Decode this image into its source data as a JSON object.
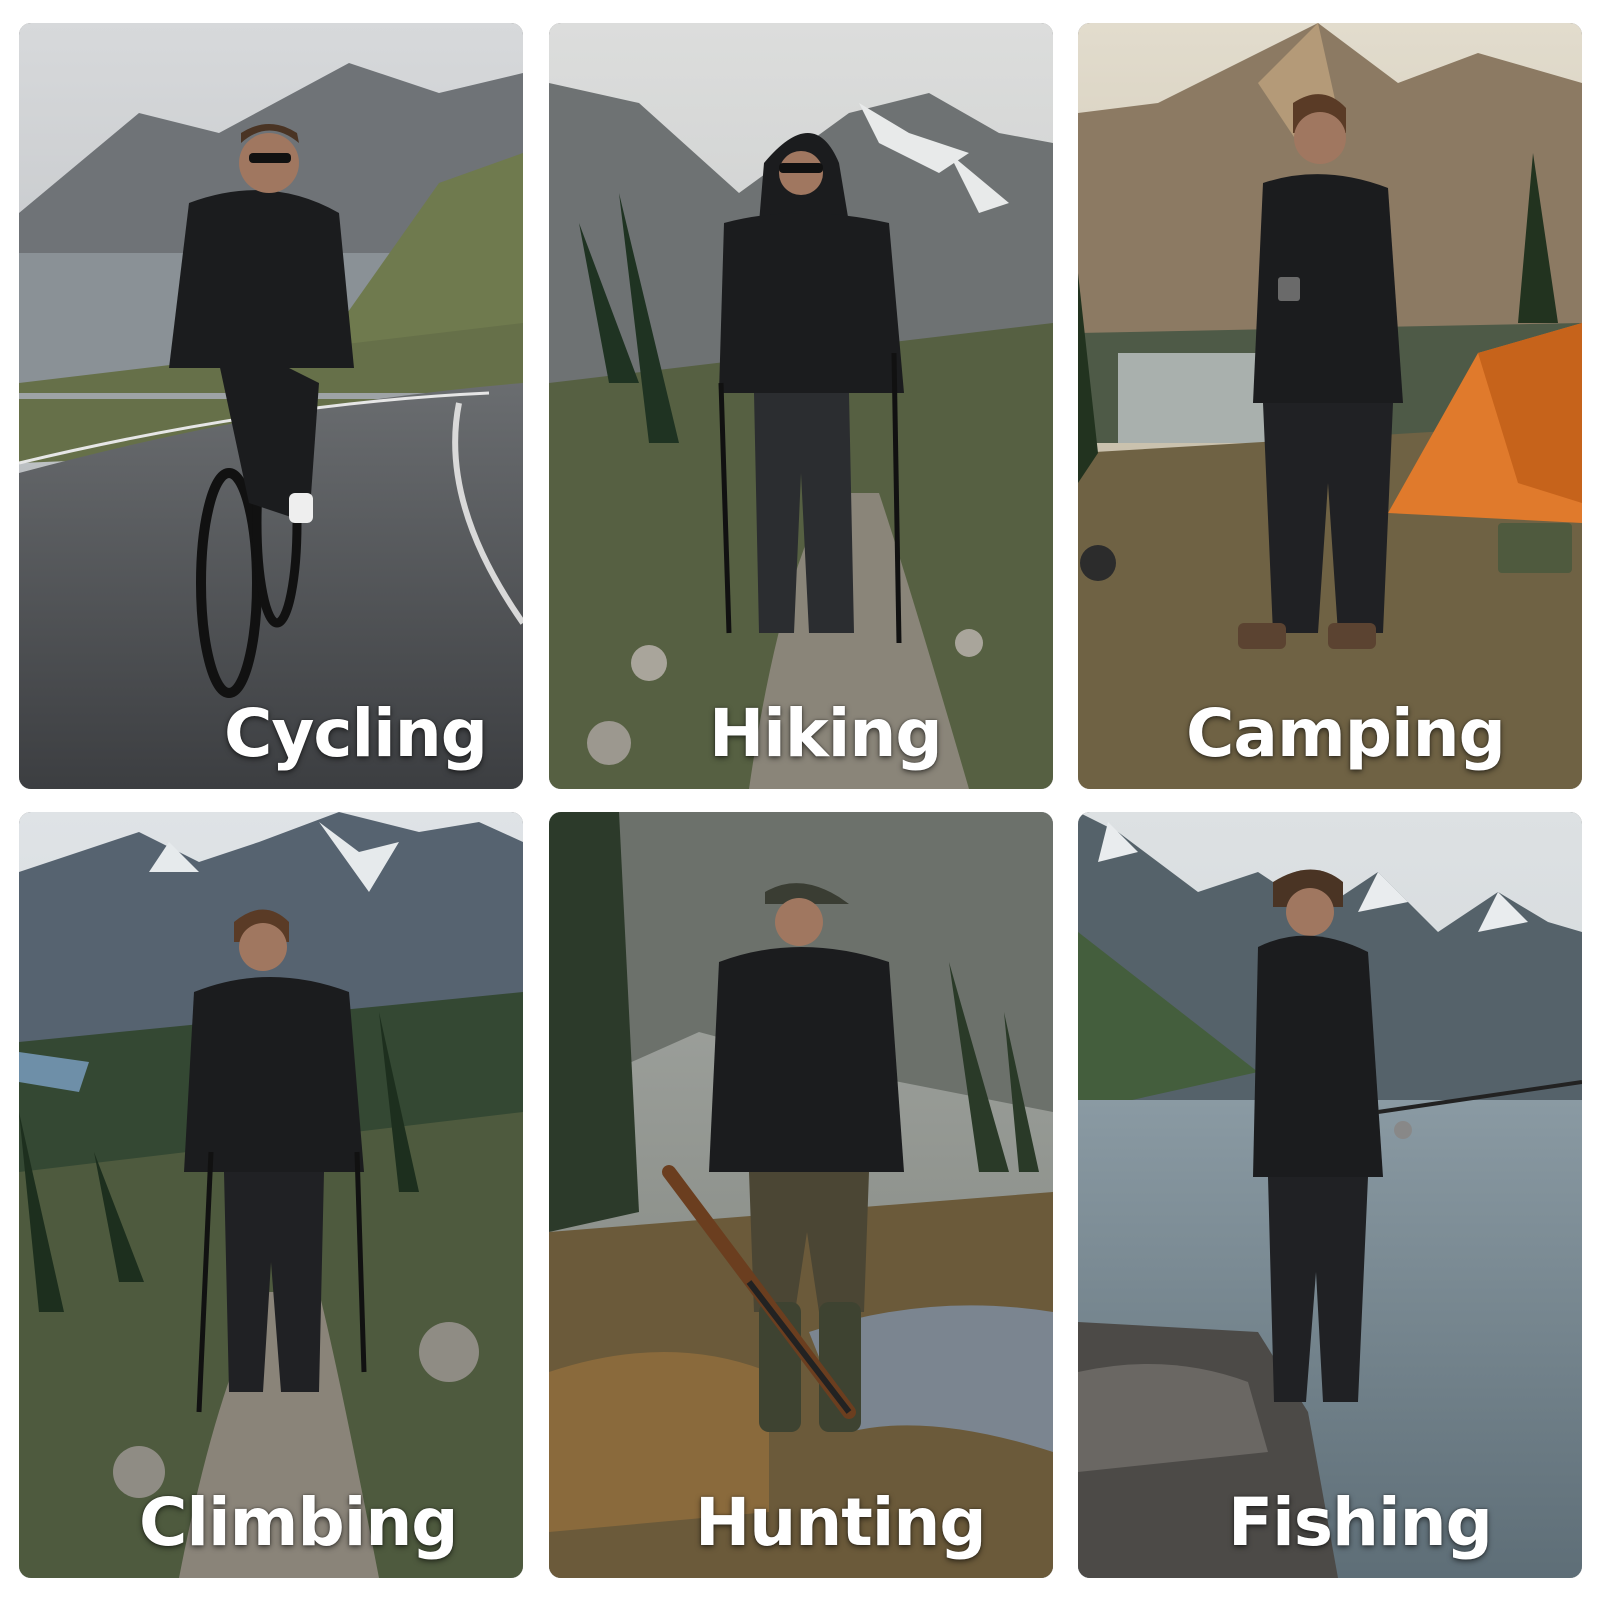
{
  "tiles": [
    {
      "label": "Cycling"
    },
    {
      "label": "Hiking"
    },
    {
      "label": "Camping"
    },
    {
      "label": "Climbing"
    },
    {
      "label": "Hunting"
    },
    {
      "label": "Fishing"
    }
  ],
  "colors": {
    "label_text": "#ffffff",
    "background": "#ffffff",
    "jacket": "#1b1c1e",
    "tent": "#e07a2c"
  }
}
